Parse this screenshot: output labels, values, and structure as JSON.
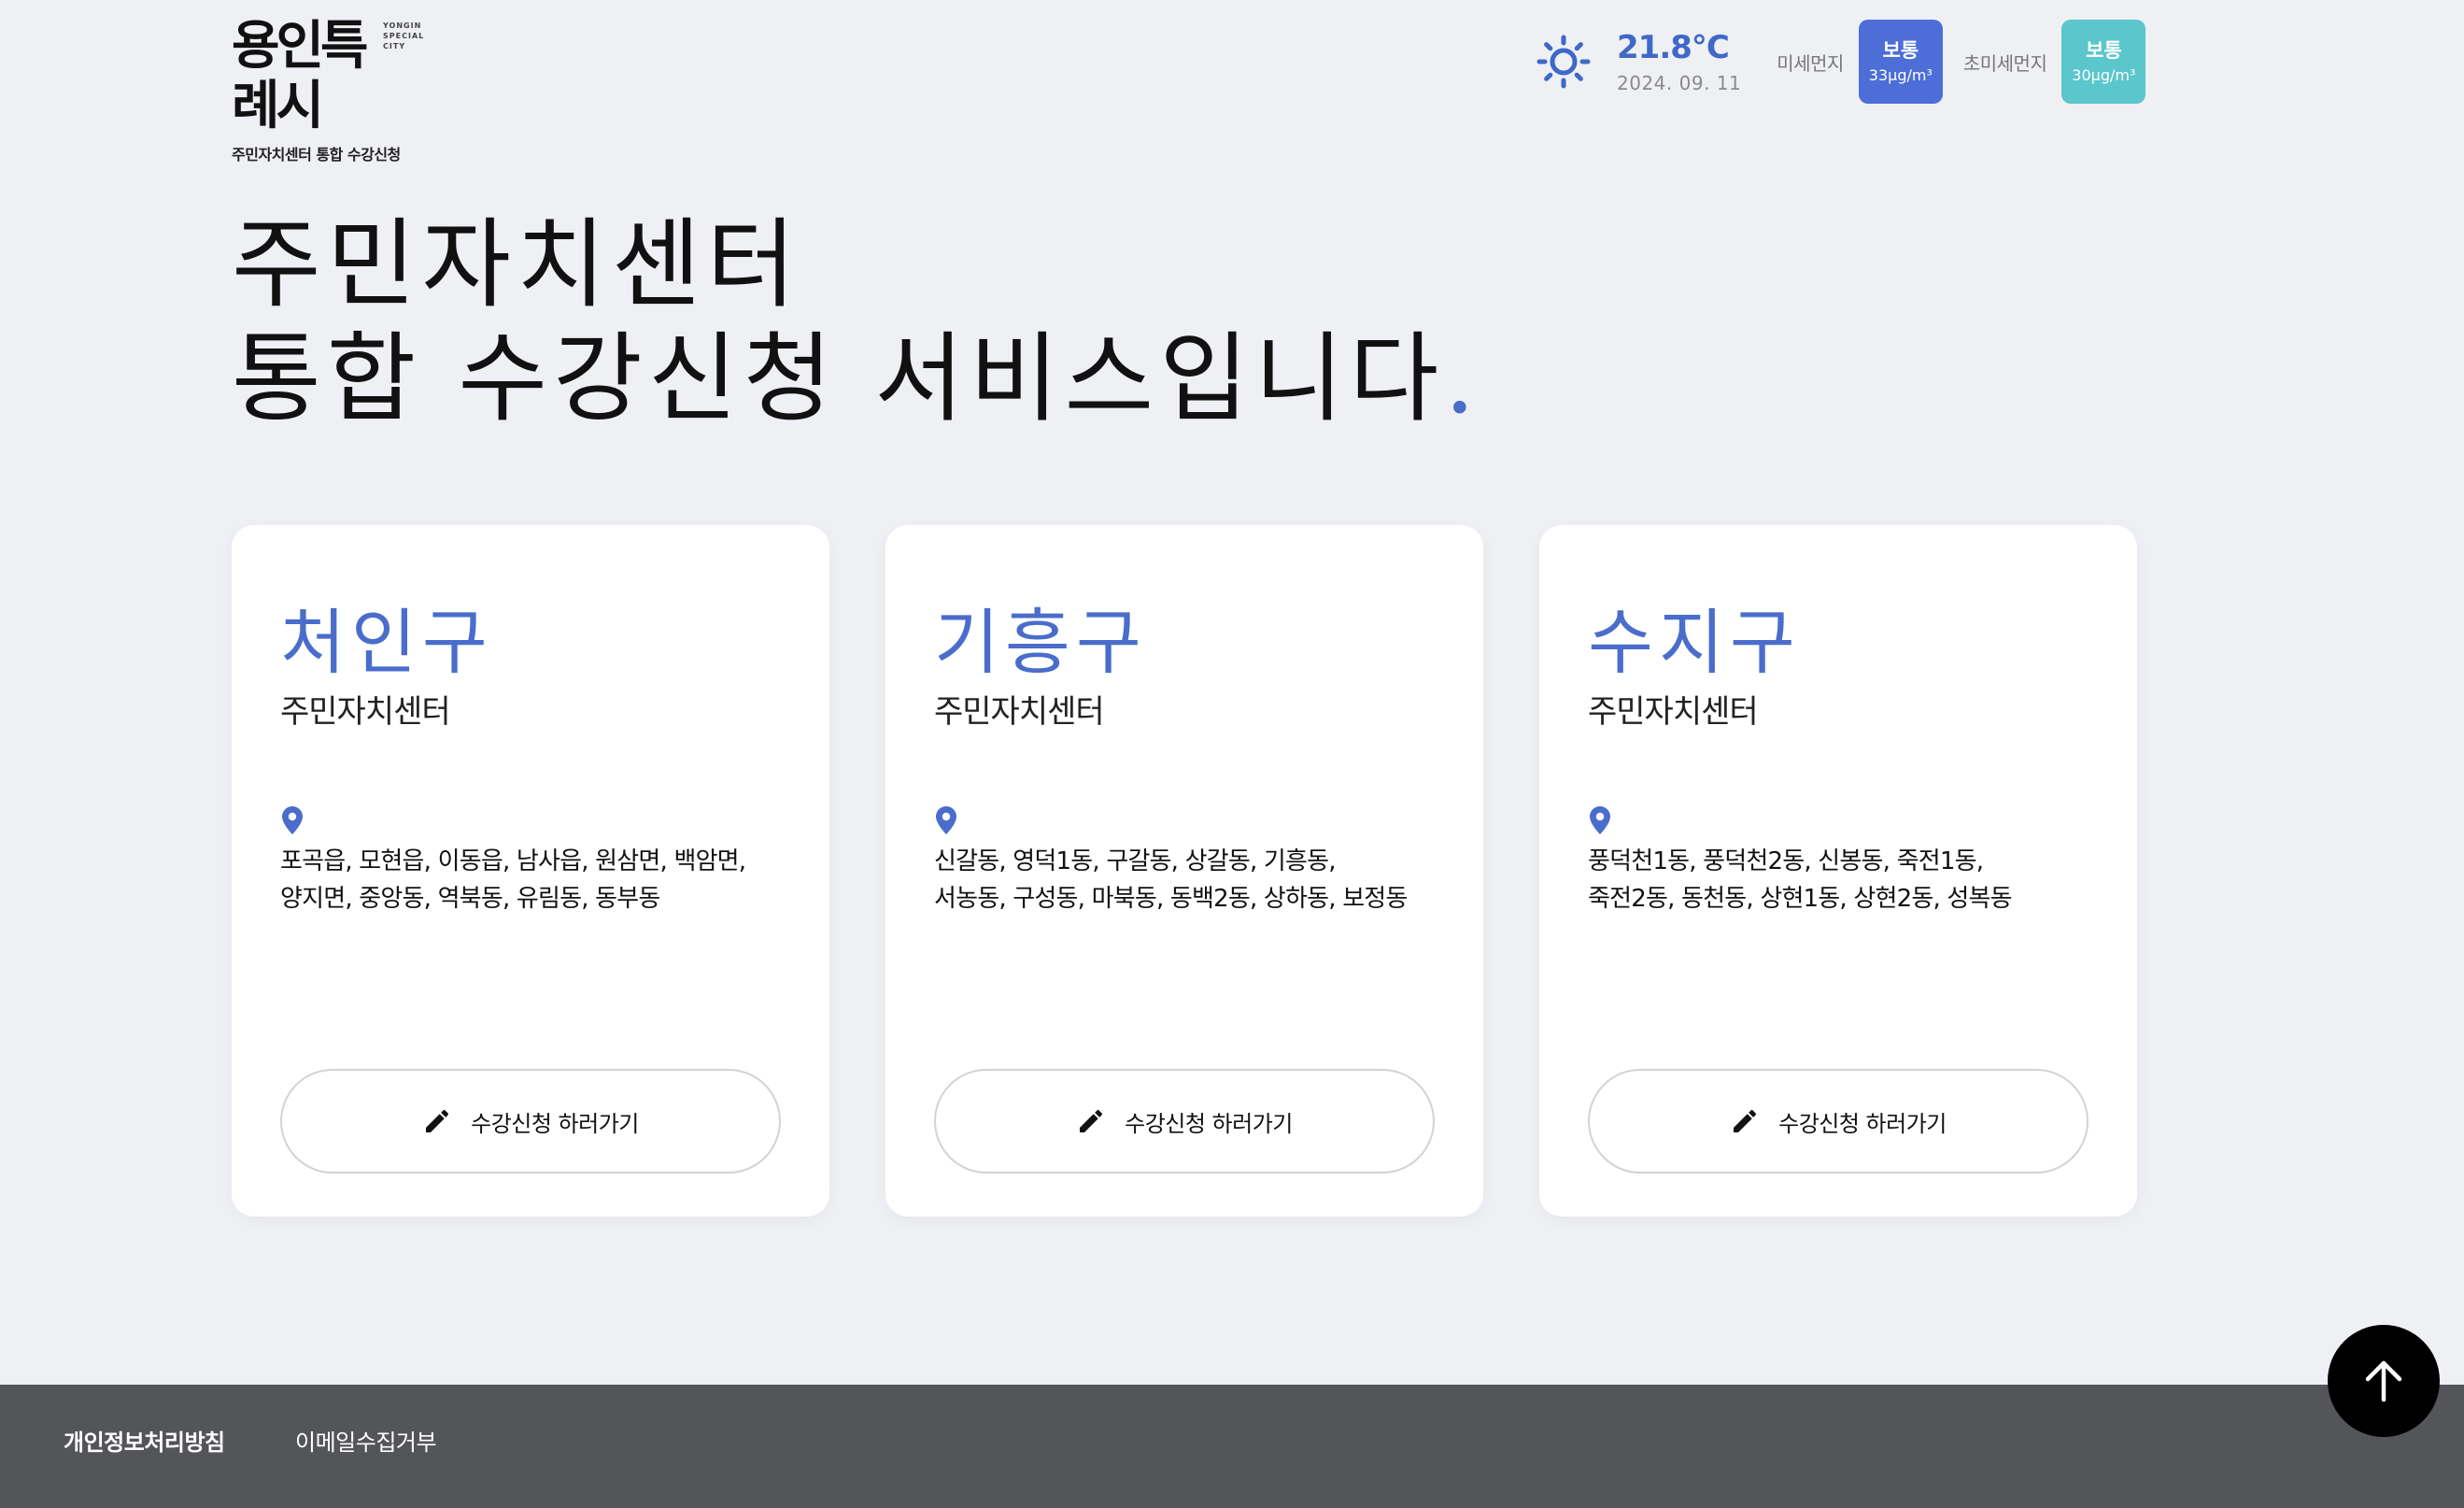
{
  "header": {
    "logo": {
      "wordmark": "용인특례시",
      "english_top": "YONGIN",
      "english_bottom": "SPECIAL CITY",
      "subtitle": "주민자치센터 통합 수강신청"
    },
    "weather": {
      "icon": "sun-icon",
      "temperature": "21.8°C",
      "date": "2024. 09. 11",
      "fine_dust": {
        "label": "미세먼지",
        "status": "보통",
        "value": "33μg/m³",
        "color": "#4c6ed6"
      },
      "ultra_fine_dust": {
        "label": "초미세먼지",
        "status": "보통",
        "value": "30μg/m³",
        "color": "#5bc6cc"
      }
    }
  },
  "hero": {
    "line1": "주민자치센터",
    "line2": "통합 수강신청 서비스입니다",
    "dot": "."
  },
  "cards": [
    {
      "district": "처인구",
      "center_label": "주민자치센터",
      "areas_line1": "포곡읍, 모현읍, 이동읍, 남사읍, 원삼면, 백암면,",
      "areas_line2": "양지면, 중앙동, 역북동, 유림동, 동부동",
      "button_label": "수강신청 하러가기"
    },
    {
      "district": "기흥구",
      "center_label": "주민자치센터",
      "areas_line1": "신갈동, 영덕1동, 구갈동, 상갈동, 기흥동,",
      "areas_line2": "서농동, 구성동, 마북동, 동백2동, 상하동, 보정동",
      "button_label": "수강신청 하러가기"
    },
    {
      "district": "수지구",
      "center_label": "주민자치센터",
      "areas_line1": "풍덕천1동, 풍덕천2동, 신봉동, 죽전1동,",
      "areas_line2": "죽전2동, 동천동, 상현1동, 상현2동, 성복동",
      "button_label": "수강신청 하러가기"
    }
  ],
  "footer": {
    "privacy_link": "개인정보처리방침",
    "email_link": "이메일수집거부"
  },
  "scroll_top": {
    "icon": "arrow-up-icon"
  },
  "colors": {
    "accent": "#4a6dcc",
    "background": "#eff0f4",
    "footer": "#545559"
  }
}
